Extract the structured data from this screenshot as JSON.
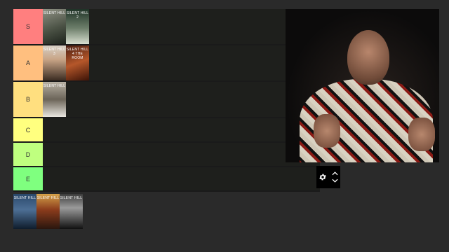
{
  "tiers": [
    {
      "label": "S",
      "color": "#ff7f7f"
    },
    {
      "label": "A",
      "color": "#ffbf7f"
    },
    {
      "label": "B",
      "color": "#ffdf7f"
    },
    {
      "label": "C",
      "color": "#ffff7f"
    },
    {
      "label": "D",
      "color": "#bfff7f"
    },
    {
      "label": "E",
      "color": "#7fff7f"
    }
  ],
  "covers": {
    "s1": "SILENT HILL",
    "s2": "SILENT HILL 2",
    "a1": "SILENT HILL 3",
    "a2": "SILENT HILL 4 THE ROOM",
    "b1": "SILENT HILL",
    "t1": "SILENT HILL",
    "t2": "SILENT HILL",
    "t3": "SILENT HILL"
  },
  "icons": {
    "settings": "gear-icon",
    "up": "chevron-up-icon",
    "down": "chevron-down-icon"
  }
}
